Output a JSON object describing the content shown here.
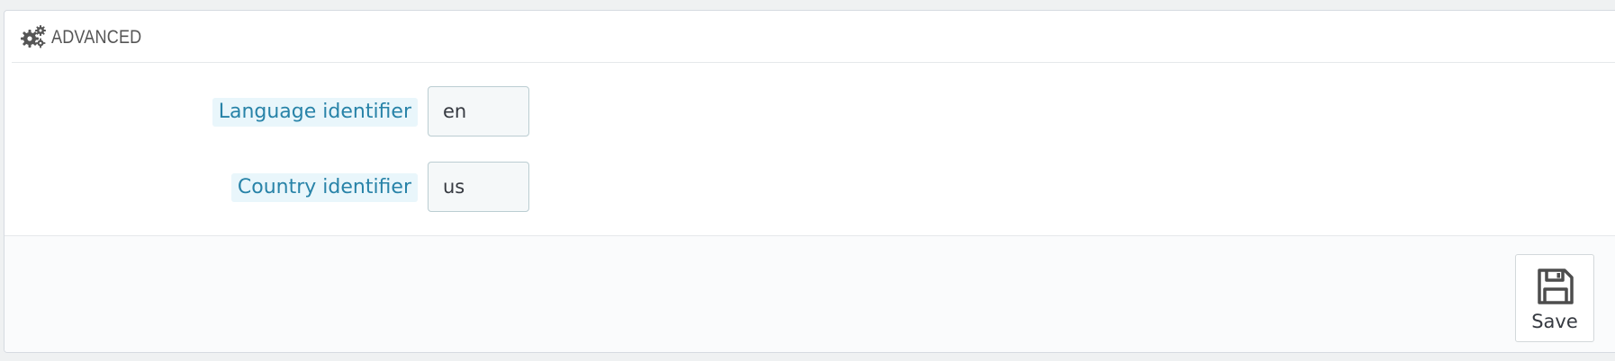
{
  "panel": {
    "title": "ADVANCED",
    "icon": "cogs-icon"
  },
  "form": {
    "language": {
      "label": "Language identifier",
      "value": "en"
    },
    "country": {
      "label": "Country identifier",
      "value": "us"
    }
  },
  "footer": {
    "save_label": "Save",
    "save_icon": "floppy-disk-icon"
  },
  "colors": {
    "label_text": "#2883a8",
    "label_background": "#e9f6fb",
    "input_background": "#f5f8f9",
    "input_border": "#bbcdd2",
    "footer_background": "#fafbfc"
  }
}
